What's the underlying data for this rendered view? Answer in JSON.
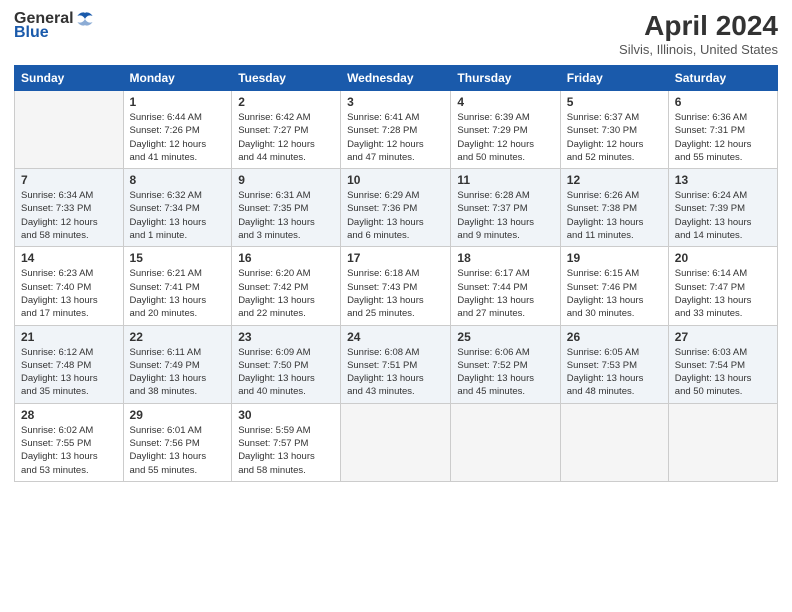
{
  "header": {
    "logo_general": "General",
    "logo_blue": "Blue",
    "title": "April 2024",
    "subtitle": "Silvis, Illinois, United States"
  },
  "days_of_week": [
    "Sunday",
    "Monday",
    "Tuesday",
    "Wednesday",
    "Thursday",
    "Friday",
    "Saturday"
  ],
  "weeks": [
    [
      {
        "num": "",
        "info": ""
      },
      {
        "num": "1",
        "info": "Sunrise: 6:44 AM\nSunset: 7:26 PM\nDaylight: 12 hours\nand 41 minutes."
      },
      {
        "num": "2",
        "info": "Sunrise: 6:42 AM\nSunset: 7:27 PM\nDaylight: 12 hours\nand 44 minutes."
      },
      {
        "num": "3",
        "info": "Sunrise: 6:41 AM\nSunset: 7:28 PM\nDaylight: 12 hours\nand 47 minutes."
      },
      {
        "num": "4",
        "info": "Sunrise: 6:39 AM\nSunset: 7:29 PM\nDaylight: 12 hours\nand 50 minutes."
      },
      {
        "num": "5",
        "info": "Sunrise: 6:37 AM\nSunset: 7:30 PM\nDaylight: 12 hours\nand 52 minutes."
      },
      {
        "num": "6",
        "info": "Sunrise: 6:36 AM\nSunset: 7:31 PM\nDaylight: 12 hours\nand 55 minutes."
      }
    ],
    [
      {
        "num": "7",
        "info": "Sunrise: 6:34 AM\nSunset: 7:33 PM\nDaylight: 12 hours\nand 58 minutes."
      },
      {
        "num": "8",
        "info": "Sunrise: 6:32 AM\nSunset: 7:34 PM\nDaylight: 13 hours\nand 1 minute."
      },
      {
        "num": "9",
        "info": "Sunrise: 6:31 AM\nSunset: 7:35 PM\nDaylight: 13 hours\nand 3 minutes."
      },
      {
        "num": "10",
        "info": "Sunrise: 6:29 AM\nSunset: 7:36 PM\nDaylight: 13 hours\nand 6 minutes."
      },
      {
        "num": "11",
        "info": "Sunrise: 6:28 AM\nSunset: 7:37 PM\nDaylight: 13 hours\nand 9 minutes."
      },
      {
        "num": "12",
        "info": "Sunrise: 6:26 AM\nSunset: 7:38 PM\nDaylight: 13 hours\nand 11 minutes."
      },
      {
        "num": "13",
        "info": "Sunrise: 6:24 AM\nSunset: 7:39 PM\nDaylight: 13 hours\nand 14 minutes."
      }
    ],
    [
      {
        "num": "14",
        "info": "Sunrise: 6:23 AM\nSunset: 7:40 PM\nDaylight: 13 hours\nand 17 minutes."
      },
      {
        "num": "15",
        "info": "Sunrise: 6:21 AM\nSunset: 7:41 PM\nDaylight: 13 hours\nand 20 minutes."
      },
      {
        "num": "16",
        "info": "Sunrise: 6:20 AM\nSunset: 7:42 PM\nDaylight: 13 hours\nand 22 minutes."
      },
      {
        "num": "17",
        "info": "Sunrise: 6:18 AM\nSunset: 7:43 PM\nDaylight: 13 hours\nand 25 minutes."
      },
      {
        "num": "18",
        "info": "Sunrise: 6:17 AM\nSunset: 7:44 PM\nDaylight: 13 hours\nand 27 minutes."
      },
      {
        "num": "19",
        "info": "Sunrise: 6:15 AM\nSunset: 7:46 PM\nDaylight: 13 hours\nand 30 minutes."
      },
      {
        "num": "20",
        "info": "Sunrise: 6:14 AM\nSunset: 7:47 PM\nDaylight: 13 hours\nand 33 minutes."
      }
    ],
    [
      {
        "num": "21",
        "info": "Sunrise: 6:12 AM\nSunset: 7:48 PM\nDaylight: 13 hours\nand 35 minutes."
      },
      {
        "num": "22",
        "info": "Sunrise: 6:11 AM\nSunset: 7:49 PM\nDaylight: 13 hours\nand 38 minutes."
      },
      {
        "num": "23",
        "info": "Sunrise: 6:09 AM\nSunset: 7:50 PM\nDaylight: 13 hours\nand 40 minutes."
      },
      {
        "num": "24",
        "info": "Sunrise: 6:08 AM\nSunset: 7:51 PM\nDaylight: 13 hours\nand 43 minutes."
      },
      {
        "num": "25",
        "info": "Sunrise: 6:06 AM\nSunset: 7:52 PM\nDaylight: 13 hours\nand 45 minutes."
      },
      {
        "num": "26",
        "info": "Sunrise: 6:05 AM\nSunset: 7:53 PM\nDaylight: 13 hours\nand 48 minutes."
      },
      {
        "num": "27",
        "info": "Sunrise: 6:03 AM\nSunset: 7:54 PM\nDaylight: 13 hours\nand 50 minutes."
      }
    ],
    [
      {
        "num": "28",
        "info": "Sunrise: 6:02 AM\nSunset: 7:55 PM\nDaylight: 13 hours\nand 53 minutes."
      },
      {
        "num": "29",
        "info": "Sunrise: 6:01 AM\nSunset: 7:56 PM\nDaylight: 13 hours\nand 55 minutes."
      },
      {
        "num": "30",
        "info": "Sunrise: 5:59 AM\nSunset: 7:57 PM\nDaylight: 13 hours\nand 58 minutes."
      },
      {
        "num": "",
        "info": ""
      },
      {
        "num": "",
        "info": ""
      },
      {
        "num": "",
        "info": ""
      },
      {
        "num": "",
        "info": ""
      }
    ]
  ]
}
